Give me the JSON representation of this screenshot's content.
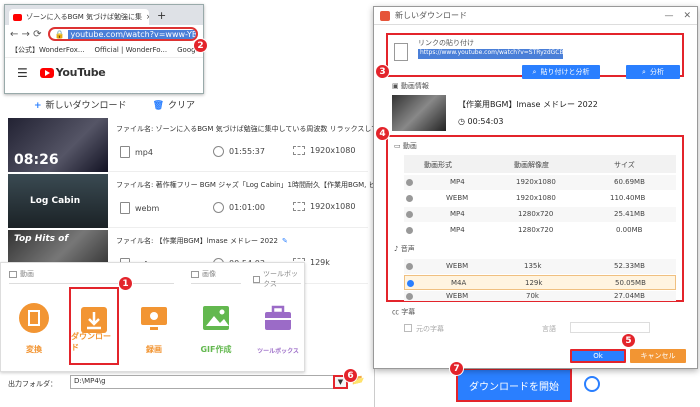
{
  "browser": {
    "tab_title": "ゾーンに入るBGM 気づけば勉強に集",
    "new_tab": "+",
    "address": "youtube.com/watch?v=www-YBK4NAvY",
    "bookmarks": [
      "【公式】WonderFox...",
      "Official | WonderFo...",
      "Google アカウント"
    ],
    "yt_logo": "YouTube",
    "nav_glyphs": "← → ⟳"
  },
  "toolbar": {
    "new_download": "新しいダウンロード",
    "clear": "クリア"
  },
  "downloads": [
    {
      "thumb_text": "08:26",
      "fname": "ファイル名: ゾーンに入るBGM 気づけば勉強に集中している周波数 リラックスして眠る2時間",
      "format": "mp4",
      "duration": "01:55:37",
      "resolution": "1920x1080"
    },
    {
      "thumb_text": "Log Cabin",
      "fname": "ファイル名: 著作権フリー BGM ジャズ「Log Cabin」1時間耐久【作業用BGM, ピアノ, 落ち着く】",
      "format": "webm",
      "duration": "01:01:00",
      "resolution": "1920x1080"
    },
    {
      "thumb_text": "Top Hits of",
      "fname": "ファイル名: 【作業用BGM】lmase メドレー 2022",
      "format": "m4a",
      "duration": "00:54:03",
      "resolution": "129k"
    }
  ],
  "toolbox": {
    "sections": [
      "動画",
      "画像",
      "ツールボックス"
    ],
    "tools": [
      "変換",
      "ダウンロード",
      "録画",
      "GIF作成",
      "ツールボックス"
    ]
  },
  "output": {
    "label": "出力フォルダ：",
    "path": "D:\\MP4\\g"
  },
  "download_start": "ダウンロードを開始",
  "dialog": {
    "title": "新しいダウンロード",
    "paste_label": "リンクの貼り付け",
    "url": "https://www.youtube.com/watch?v=STRyzdGCBg4",
    "paste_analyze": "貼り付けと分析",
    "analyze": "分析",
    "video_info": "動画情報",
    "video_title": "【作業用BGM】lmase メドレー 2022",
    "video_duration": "00:54:03",
    "video_section": "動画",
    "col_format": "動画形式",
    "col_res": "動画解像度",
    "col_size": "サイズ",
    "video_rows": [
      {
        "format": "MP4",
        "res": "1920x1080",
        "size": "60.69MB"
      },
      {
        "format": "WEBM",
        "res": "1920x1080",
        "size": "110.40MB"
      },
      {
        "format": "MP4",
        "res": "1280x720",
        "size": "25.41MB"
      },
      {
        "format": "MP4",
        "res": "1280x720",
        "size": "0.00MB"
      }
    ],
    "audio_section": "音声",
    "audio_rows": [
      {
        "format": "WEBM",
        "res": "135k",
        "size": "52.33MB"
      },
      {
        "format": "M4A",
        "res": "129k",
        "size": "50.05MB"
      },
      {
        "format": "WEBM",
        "res": "70k",
        "size": "27.04MB"
      }
    ],
    "subtitle_section": "字幕",
    "orig_sub": "元の字幕",
    "language": "言語",
    "ok": "Ok",
    "cancel": "キャンセル"
  },
  "badges": [
    "1",
    "2",
    "3",
    "4",
    "5",
    "6",
    "7"
  ],
  "colors": {
    "accent": "#2a7fff",
    "badge": "#e3242b",
    "tool_orange": "#f29533",
    "tool_green": "#63b84f",
    "tool_purple": "#9b6bc7"
  }
}
